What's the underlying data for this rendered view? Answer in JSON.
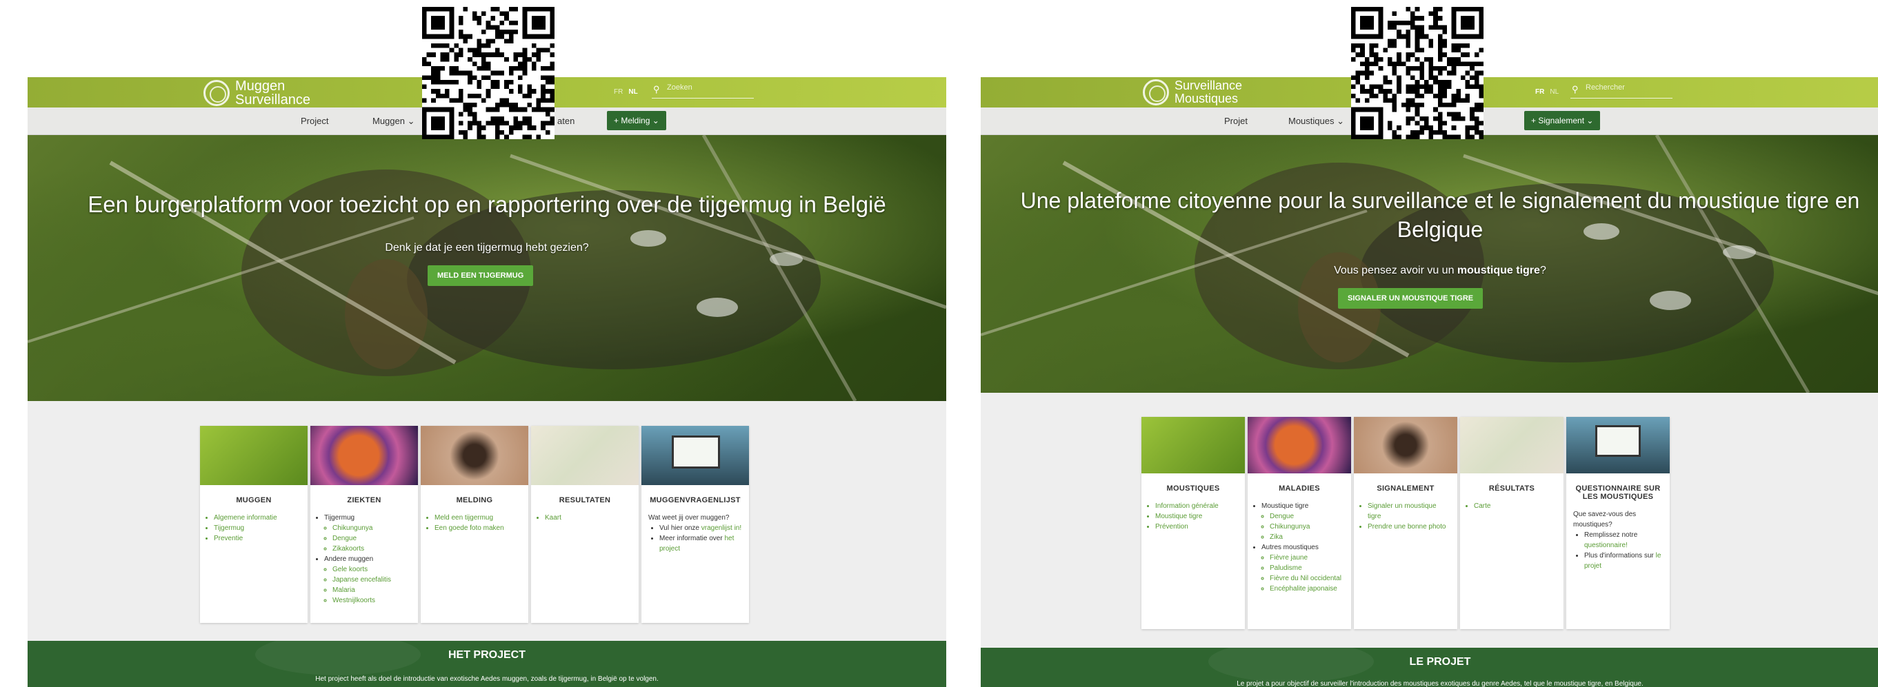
{
  "colors": {
    "accent": "#5aa83a",
    "topbar": "#a9c23e",
    "dark_green": "#2f6530",
    "nav_bg": "#e8e8e6"
  },
  "nl": {
    "logo": {
      "line1": "Muggen",
      "line2": "Surveillance"
    },
    "langs": {
      "fr": "FR",
      "nl": "NL"
    },
    "search": {
      "placeholder": "Zoeken"
    },
    "nav": {
      "project": "Project",
      "muggen": "Muggen ⌄",
      "resultaten": "aten",
      "melding": "+ Melding ⌄"
    },
    "hero": {
      "title": "Een burgerplatform voor toezicht op en rapportering over de tijgermug in België",
      "question": "Denk je dat je een tijgermug hebt gezien?",
      "cta": "MELD EEN TIJGERMUG"
    },
    "cards": [
      {
        "title": "MUGGEN",
        "items": [
          "Algemene informatie",
          "Tijgermug",
          "Preventie"
        ]
      },
      {
        "title": "ZIEKTEN",
        "items": [
          "Tijgermug"
        ],
        "sub1": [
          "Chikungunya",
          "Dengue",
          "Zikakoorts"
        ],
        "item2": "Andere muggen",
        "sub2": [
          "Gele koorts",
          "Japanse encefalitis",
          "Malaria",
          "Westnijlkoorts"
        ]
      },
      {
        "title": "MELDING",
        "items": [
          "Meld een tijgermug",
          "Een goede foto maken"
        ]
      },
      {
        "title": "RESULTATEN",
        "items": [
          "Kaart"
        ]
      },
      {
        "title": "MUGGENVRAGENLIJST",
        "intro": "Wat weet jij over muggen?",
        "l1a": "Vul hier onze ",
        "l1b": "vragenlijst in!",
        "l2a": "Meer informatie over ",
        "l2b": "het project"
      }
    ],
    "footer": {
      "title": "HET PROJECT",
      "text": "Het project heeft als doel de introductie van exotische Aedes muggen, zoals de tijgermug, in België op te volgen."
    }
  },
  "fr": {
    "logo": {
      "line1": "Surveillance",
      "line2": "Moustiques"
    },
    "langs": {
      "fr": "FR",
      "nl": "NL"
    },
    "search": {
      "placeholder": "Rechercher"
    },
    "nav": {
      "project": "Projet",
      "muggen": "Moustiques ⌄",
      "melding": "+ Signalement ⌄"
    },
    "hero": {
      "title": "Une plateforme citoyenne pour la surveillance et le signalement du moustique tigre en Belgique",
      "question_a": "Vous pensez avoir vu un ",
      "question_b": "moustique tigre",
      "question_c": "?",
      "cta": "SIGNALER UN MOUSTIQUE TIGRE"
    },
    "cards": [
      {
        "title": "MOUSTIQUES",
        "items": [
          "Information générale",
          "Moustique tigre",
          "Prévention"
        ]
      },
      {
        "title": "MALADIES",
        "items": [
          "Moustique tigre"
        ],
        "sub1": [
          "Dengue",
          "Chikungunya",
          "Zika"
        ],
        "item2": "Autres moustiques",
        "sub2": [
          "Fièvre jaune",
          "Paludisme",
          "Fièvre du Nil occidental",
          "Encéphalite japonaise"
        ]
      },
      {
        "title": "SIGNALEMENT",
        "items": [
          "Signaler un moustique tigre",
          "Prendre une bonne photo"
        ]
      },
      {
        "title": "RÉSULTATS",
        "items": [
          "Carte"
        ]
      },
      {
        "title": "QUESTIONNAIRE SUR LES MOUSTIQUES",
        "intro": "Que savez-vous des moustiques?",
        "l1a": "Remplissez notre ",
        "l1b": "questionnaire!",
        "l2a": "Plus d'informations sur ",
        "l2b": "le projet"
      }
    ],
    "footer": {
      "title": "LE PROJET",
      "text": "Le projet a pour objectif de surveiller l'introduction des moustiques exotiques du genre Aedes, tel que le moustique tigre, en Belgique."
    }
  }
}
